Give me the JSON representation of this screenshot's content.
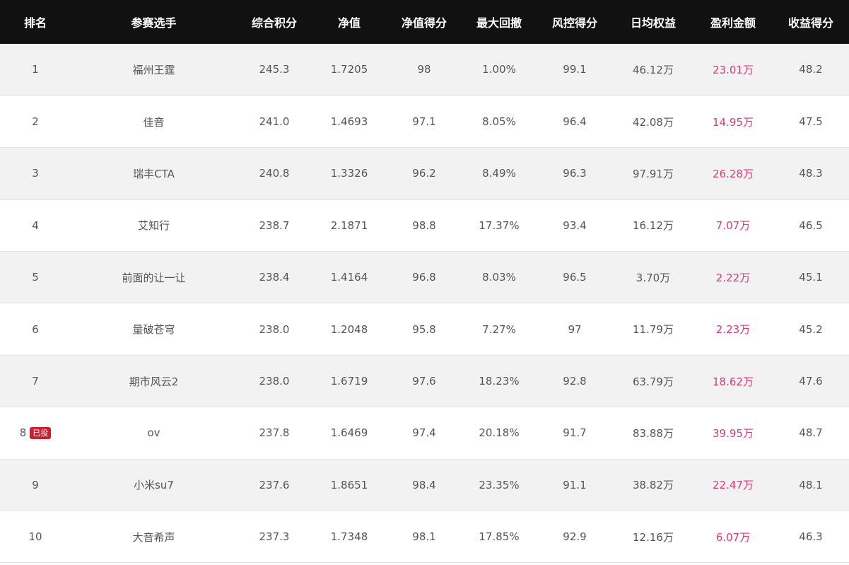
{
  "headers": [
    "排名",
    "参赛选手",
    "综合积分",
    "净值",
    "净值得分",
    "最大回撤",
    "风控得分",
    "日均权益",
    "盈利金额",
    "收益得分"
  ],
  "colors": {
    "header_bg": "#111111",
    "profit": "#e0377a",
    "badge": "#c8202f"
  },
  "rows": [
    {
      "rank": "1",
      "badge": "",
      "name": "福州王霆",
      "score": "245.3",
      "nav": "1.7205",
      "nav_score": "98",
      "max_dd": "1.00%",
      "risk_score": "99.1",
      "daily_equity": "46.12万",
      "profit": "23.01万",
      "return_score": "48.2"
    },
    {
      "rank": "2",
      "badge": "",
      "name": "佳音",
      "score": "241.0",
      "nav": "1.4693",
      "nav_score": "97.1",
      "max_dd": "8.05%",
      "risk_score": "96.4",
      "daily_equity": "42.08万",
      "profit": "14.95万",
      "return_score": "47.5"
    },
    {
      "rank": "3",
      "badge": "",
      "name": "瑞丰CTA",
      "score": "240.8",
      "nav": "1.3326",
      "nav_score": "96.2",
      "max_dd": "8.49%",
      "risk_score": "96.3",
      "daily_equity": "97.91万",
      "profit": "26.28万",
      "return_score": "48.3"
    },
    {
      "rank": "4",
      "badge": "",
      "name": "艾知行",
      "score": "238.7",
      "nav": "2.1871",
      "nav_score": "98.8",
      "max_dd": "17.37%",
      "risk_score": "93.4",
      "daily_equity": "16.12万",
      "profit": "7.07万",
      "return_score": "46.5"
    },
    {
      "rank": "5",
      "badge": "",
      "name": "前面的让一让",
      "score": "238.4",
      "nav": "1.4164",
      "nav_score": "96.8",
      "max_dd": "8.03%",
      "risk_score": "96.5",
      "daily_equity": "3.70万",
      "profit": "2.22万",
      "return_score": "45.1"
    },
    {
      "rank": "6",
      "badge": "",
      "name": "量破苍穹",
      "score": "238.0",
      "nav": "1.2048",
      "nav_score": "95.8",
      "max_dd": "7.27%",
      "risk_score": "97",
      "daily_equity": "11.79万",
      "profit": "2.23万",
      "return_score": "45.2"
    },
    {
      "rank": "7",
      "badge": "",
      "name": "期市风云2",
      "score": "238.0",
      "nav": "1.6719",
      "nav_score": "97.6",
      "max_dd": "18.23%",
      "risk_score": "92.8",
      "daily_equity": "63.79万",
      "profit": "18.62万",
      "return_score": "47.6"
    },
    {
      "rank": "8",
      "badge": "已投",
      "name": "ov",
      "score": "237.8",
      "nav": "1.6469",
      "nav_score": "97.4",
      "max_dd": "20.18%",
      "risk_score": "91.7",
      "daily_equity": "83.88万",
      "profit": "39.95万",
      "return_score": "48.7"
    },
    {
      "rank": "9",
      "badge": "",
      "name": "小米su7",
      "score": "237.6",
      "nav": "1.8651",
      "nav_score": "98.4",
      "max_dd": "23.35%",
      "risk_score": "91.1",
      "daily_equity": "38.82万",
      "profit": "22.47万",
      "return_score": "48.1"
    },
    {
      "rank": "10",
      "badge": "",
      "name": "大音希声",
      "score": "237.3",
      "nav": "1.7348",
      "nav_score": "98.1",
      "max_dd": "17.85%",
      "risk_score": "92.9",
      "daily_equity": "12.16万",
      "profit": "6.07万",
      "return_score": "46.3"
    }
  ]
}
